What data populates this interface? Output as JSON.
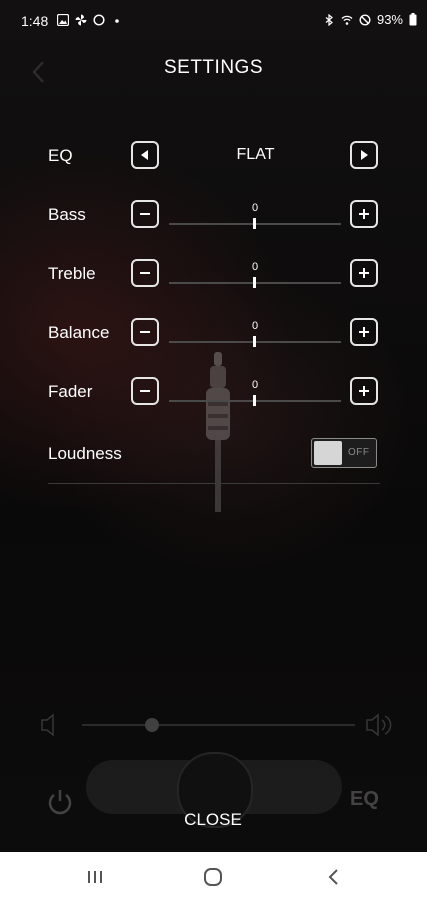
{
  "status_bar": {
    "time": "1:48",
    "battery": "93%",
    "left_icons": [
      "image-icon",
      "pinwheel-icon",
      "circle-icon",
      "dot-icon"
    ],
    "right_icons": [
      "bluetooth-icon",
      "wifi-icon",
      "do-not-disturb-icon",
      "battery-icon"
    ]
  },
  "header": {
    "title": "SETTINGS",
    "back_icon": "chevron-left-icon"
  },
  "settings": {
    "eq": {
      "label": "EQ",
      "value": "FLAT",
      "prev_icon": "triangle-left-icon",
      "next_icon": "triangle-right-icon"
    },
    "bass": {
      "label": "Bass",
      "value": "0",
      "level": 0
    },
    "treble": {
      "label": "Treble",
      "value": "0",
      "level": 0
    },
    "balance": {
      "label": "Balance",
      "value": "0",
      "level": 0
    },
    "fader": {
      "label": "Fader",
      "value": "0",
      "level": 0
    },
    "loudness": {
      "label": "Loudness",
      "state": "OFF"
    }
  },
  "background": {
    "eq_label": "EQ"
  },
  "close_label": "CLOSE",
  "nav_bar": {
    "items": [
      "recent-apps-icon",
      "home-icon",
      "back-icon"
    ]
  },
  "colors": {
    "background": "#0c0a0a",
    "text": "#ffffff",
    "button_border": "#e6e6e6",
    "slider_track": "#4a4a4a",
    "toggle_off": "#8a8a8a"
  }
}
